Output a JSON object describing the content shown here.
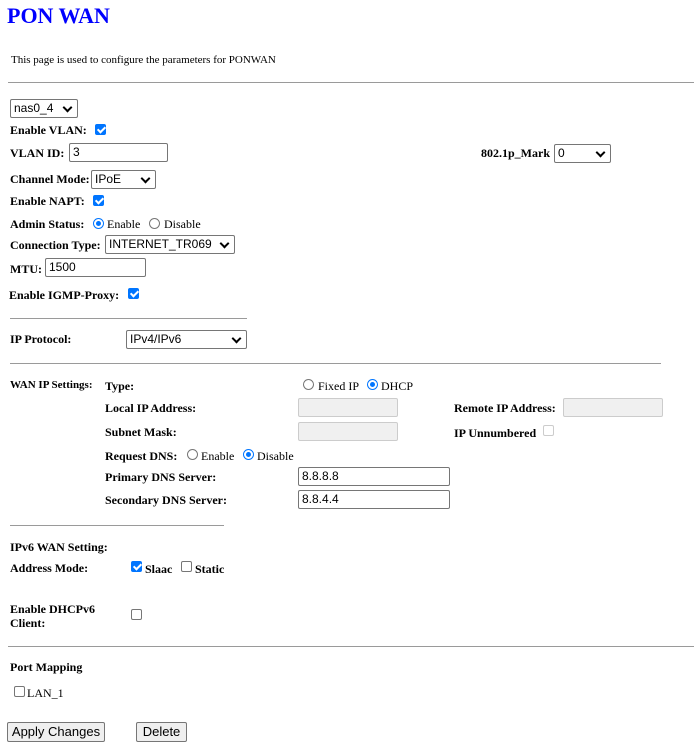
{
  "title": "PON WAN",
  "description": "This page is used to configure the parameters for PONWAN",
  "interface_select": "nas0_4",
  "enable_vlan": {
    "label": "Enable VLAN:",
    "checked": true
  },
  "vlan_id": {
    "label": "VLAN ID:",
    "value": "3"
  },
  "mark_8021p": {
    "label": "802.1p_Mark",
    "value": "0"
  },
  "channel_mode": {
    "label": "Channel Mode:",
    "value": "IPoE"
  },
  "enable_napt": {
    "label": "Enable NAPT:",
    "checked": true
  },
  "admin_status": {
    "label": "Admin Status:",
    "options": [
      "Enable",
      "Disable"
    ],
    "selected": "Enable"
  },
  "connection_type": {
    "label": "Connection Type:",
    "value": "INTERNET_TR069"
  },
  "mtu": {
    "label": "MTU:",
    "value": "1500"
  },
  "igmp_proxy": {
    "label": "Enable IGMP-Proxy:",
    "checked": true
  },
  "ip_protocol": {
    "label": "IP Protocol:",
    "value": "IPv4/IPv6"
  },
  "wan_ip": {
    "label": "WAN IP Settings:",
    "type_label": "Type:",
    "type_options": [
      "Fixed IP",
      "DHCP"
    ],
    "type_selected": "DHCP",
    "local_ip_label": "Local IP Address:",
    "local_ip": "",
    "remote_ip_label": "Remote IP Address:",
    "remote_ip": "",
    "subnet_label": "Subnet Mask:",
    "subnet": "",
    "ip_unnumbered_label": "IP Unnumbered",
    "request_dns_label": "Request DNS:",
    "request_dns_options": [
      "Enable",
      "Disable"
    ],
    "request_dns_selected": "Disable",
    "primary_dns_label": "Primary DNS Server:",
    "primary_dns": "8.8.8.8",
    "secondary_dns_label": "Secondary DNS Server:",
    "secondary_dns": "8.8.4.4"
  },
  "ipv6": {
    "heading": "IPv6 WAN Setting:",
    "address_mode_label": "Address Mode:",
    "slaac": "Slaac",
    "static": "Static",
    "slaac_checked": true,
    "static_checked": false,
    "dhcpv6_label_1": "Enable DHCPv6",
    "dhcpv6_label_2": "Client:",
    "dhcpv6_checked": false
  },
  "port_mapping": {
    "heading": "Port Mapping",
    "ports": [
      {
        "label": "LAN_1",
        "checked": false
      }
    ]
  },
  "buttons": {
    "apply": "Apply Changes",
    "delete": "Delete"
  }
}
